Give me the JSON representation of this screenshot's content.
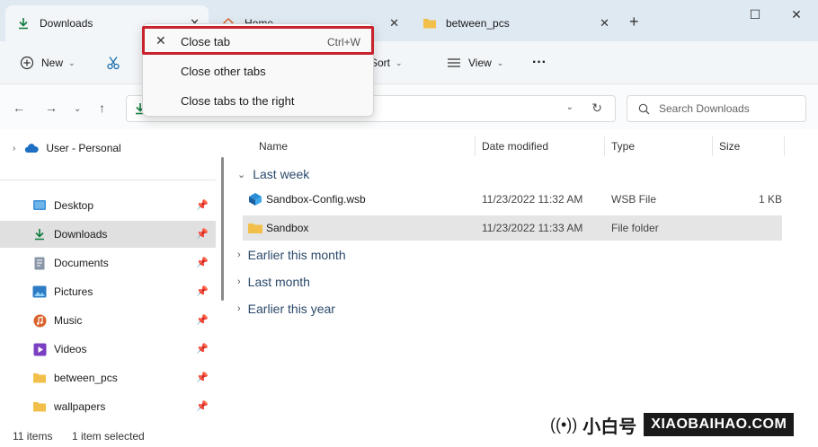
{
  "tabs": [
    {
      "label": "Downloads",
      "icon": "download-icon",
      "active": true
    },
    {
      "label": "Home",
      "icon": "home-icon",
      "active": false
    },
    {
      "label": "between_pcs",
      "icon": "folder-icon",
      "active": false
    }
  ],
  "toolbar": {
    "new_label": "New",
    "sort_label": "Sort",
    "view_label": "View",
    "more_label": "···"
  },
  "search": {
    "placeholder": "Search Downloads"
  },
  "sidebar": {
    "items": [
      {
        "label": "User - Personal",
        "icon": "cloud-icon"
      },
      {
        "label": "Desktop",
        "icon": "desktop-icon"
      },
      {
        "label": "Downloads",
        "icon": "download-icon"
      },
      {
        "label": "Documents",
        "icon": "document-icon"
      },
      {
        "label": "Pictures",
        "icon": "pictures-icon"
      },
      {
        "label": "Music",
        "icon": "music-icon"
      },
      {
        "label": "Videos",
        "icon": "video-icon"
      },
      {
        "label": "between_pcs",
        "icon": "folder-icon"
      },
      {
        "label": "wallpapers",
        "icon": "folder-icon"
      }
    ]
  },
  "columns": {
    "name": "Name",
    "date": "Date modified",
    "type": "Type",
    "size": "Size"
  },
  "groups": {
    "last_week": "Last week",
    "earlier_month": "Earlier this month",
    "last_month": "Last month",
    "earlier_year": "Earlier this year"
  },
  "files": [
    {
      "name": "Sandbox-Config.wsb",
      "date": "11/23/2022 11:32 AM",
      "type": "WSB File",
      "size": "1 KB"
    },
    {
      "name": "Sandbox",
      "date": "11/23/2022 11:33 AM",
      "type": "File folder",
      "size": ""
    }
  ],
  "status": {
    "items": "11 items",
    "selected": "1 item selected"
  },
  "context_menu": {
    "close_tab": "Close tab",
    "close_tab_shortcut": "Ctrl+W",
    "close_other": "Close other tabs",
    "close_right": "Close tabs to the right"
  },
  "watermark": {
    "cn": "小白号",
    "en": "XIAOBAIHAO.COM"
  },
  "colors": {
    "highlight": "#c8232c",
    "accent": "#0f7b3c",
    "folder": "#f2c04a"
  }
}
